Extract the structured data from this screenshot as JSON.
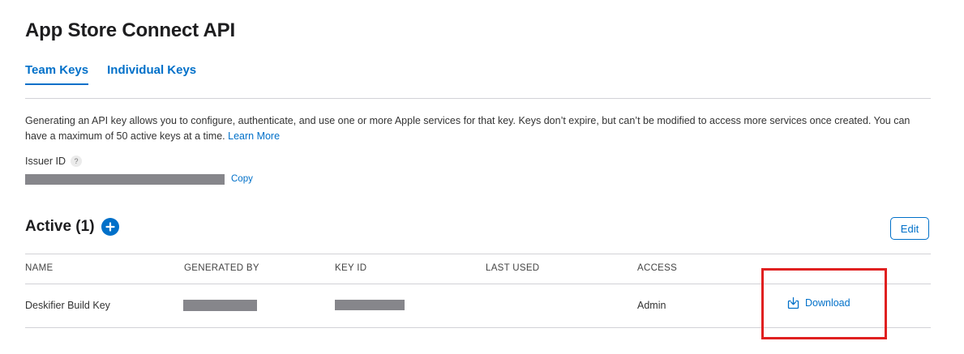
{
  "page": {
    "title": "App Store Connect API"
  },
  "tabs": [
    {
      "label": "Team Keys",
      "active": true
    },
    {
      "label": "Individual Keys",
      "active": false
    }
  ],
  "description": {
    "text": "Generating an API key allows you to configure, authenticate, and use one or more Apple services for that key. Keys don’t expire, but can’t be modified to access more services once created. You can have a maximum of 50 active keys at a time.",
    "link": "Learn More"
  },
  "issuer": {
    "label": "Issuer ID",
    "help": "?",
    "copy": "Copy"
  },
  "active": {
    "heading": "Active (1)",
    "add_icon": "plus-icon",
    "edit": "Edit"
  },
  "table": {
    "headers": [
      "NAME",
      "GENERATED BY",
      "KEY ID",
      "LAST USED",
      "ACCESS"
    ],
    "rows": [
      {
        "name": "Deskifier Build Key",
        "last_used": "",
        "access": "Admin",
        "action": "Download",
        "action_icon": "download-icon"
      }
    ]
  },
  "colors": {
    "accent": "#0070c9",
    "redaction": "#86868b",
    "highlight": "#e02020"
  }
}
